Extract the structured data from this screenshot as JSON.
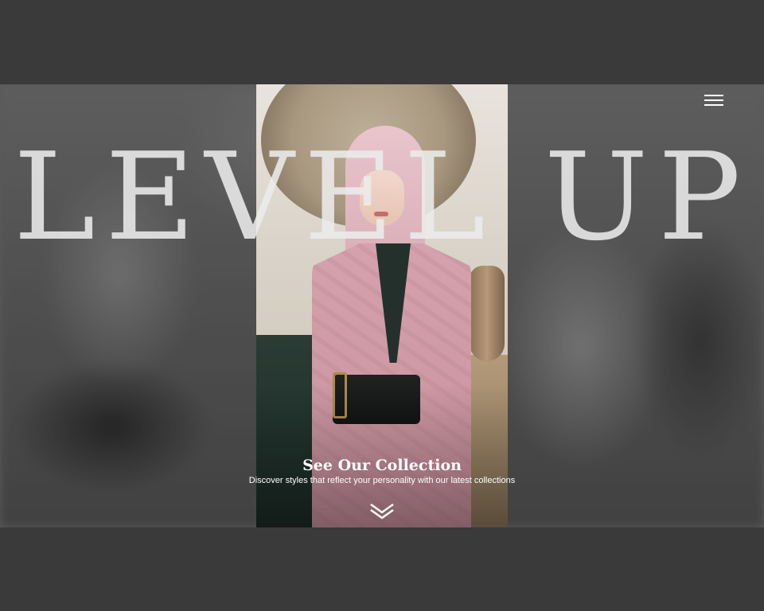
{
  "hero": {
    "title": "LEVEL UP",
    "cta_title": "See Our Collection",
    "cta_subtitle": "Discover styles that reflect your personality with our latest collections"
  },
  "header": {
    "menu_icon": "hamburger-menu-icon"
  },
  "scroll": {
    "icon": "double-chevron-down-icon"
  },
  "colors": {
    "page_background": "#3a3a3a",
    "title_text": "#ececec",
    "cta_text": "#ffffff"
  }
}
